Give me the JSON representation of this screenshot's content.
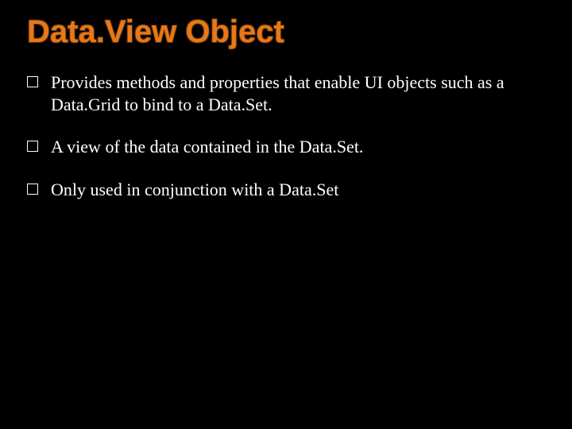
{
  "title": "Data.View Object",
  "bullets": [
    "Provides methods and properties that enable UI objects such as a Data.Grid to bind to a Data.Set.",
    "A view of the data contained in the Data.Set.",
    "Only used in conjunction with a Data.Set"
  ]
}
